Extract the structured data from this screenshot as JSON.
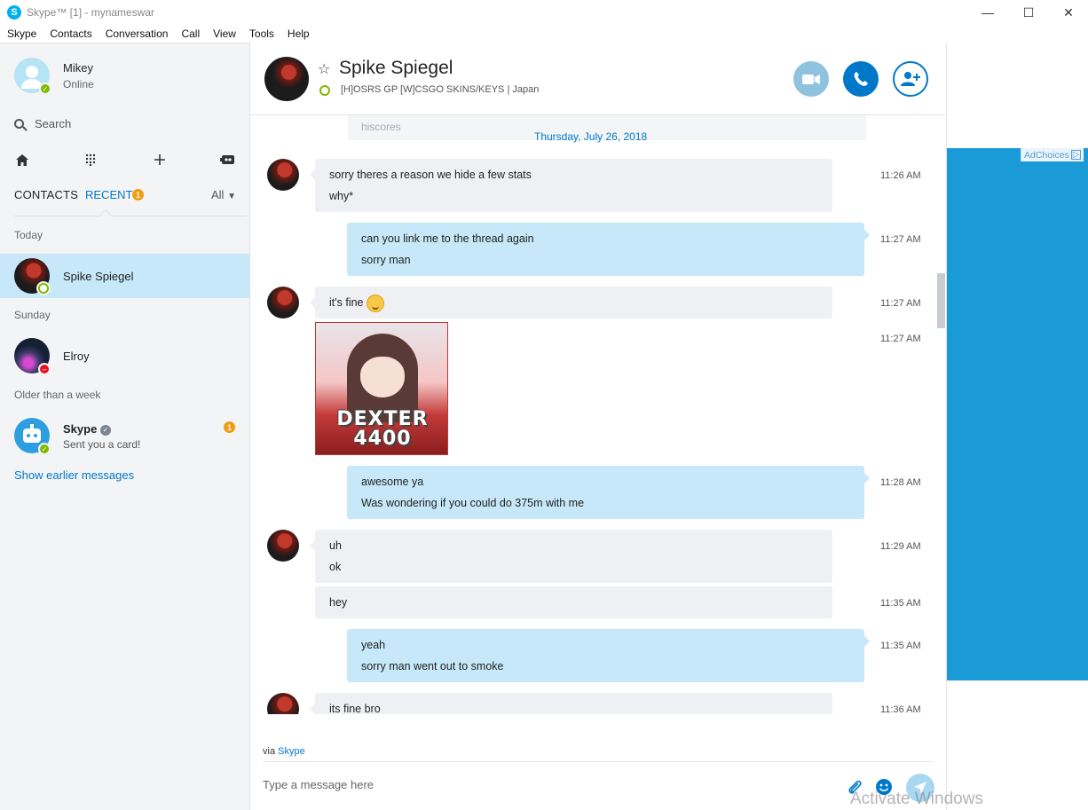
{
  "window": {
    "title": "Skype™ [1] - mynameswar",
    "minimize_glyph": "—",
    "maximize_glyph": "☐",
    "close_glyph": "✕"
  },
  "menu": [
    "Skype",
    "Contacts",
    "Conversation",
    "Call",
    "View",
    "Tools",
    "Help"
  ],
  "sidebar": {
    "me": {
      "name": "Mikey",
      "status": "Online"
    },
    "search_label": "Search",
    "tabs": {
      "contacts": "CONTACTS",
      "recent": "RECENT",
      "recent_badge": "1",
      "filter": "All"
    },
    "groups": {
      "today": "Today",
      "sunday": "Sunday",
      "older": "Older than a week"
    },
    "conversations": [
      {
        "name": "Spike Spiegel",
        "selected": true
      },
      {
        "name": "Elroy"
      },
      {
        "name": "Skype",
        "subtitle": "Sent you a card!",
        "badge": "1"
      }
    ],
    "show_earlier": "Show earlier messages"
  },
  "chat": {
    "contact_name": "Spike Spiegel",
    "mood": "[H]OSRS GP [W]CSGO SKINS/KEYS | Japan",
    "ghost_text": "hiscores",
    "date_label": "Thursday, July 26, 2018",
    "messages": [
      {
        "dir": "in",
        "lines": [
          "sorry theres a reason we hide a few stats",
          "why*"
        ],
        "time": "11:26 AM"
      },
      {
        "dir": "out",
        "lines": [
          "can you link me to the thread again",
          "sorry man"
        ],
        "time": "11:27 AM"
      },
      {
        "dir": "in",
        "lines": [
          "it's fine"
        ],
        "time": "11:27 AM"
      },
      {
        "dir": "in",
        "image_text": [
          "DEXTER",
          "4400"
        ],
        "time": "11:27 AM"
      },
      {
        "dir": "out",
        "lines": [
          "awesome ya",
          "Was wondering if you could do 375m with me"
        ],
        "time": "11:28 AM"
      },
      {
        "dir": "in",
        "lines": [
          "uh",
          "ok"
        ],
        "time": "11:29 AM"
      },
      {
        "dir": "in",
        "lines": [
          "hey"
        ],
        "time": "11:35 AM"
      },
      {
        "dir": "out",
        "lines": [
          "yeah",
          "sorry man went out to smoke"
        ],
        "time": "11:35 AM"
      },
      {
        "dir": "in",
        "lines": [
          "its fine bro"
        ],
        "time": "11:36 AM"
      }
    ],
    "via_prefix": "via",
    "via_link": "Skype",
    "composer_placeholder": "Type a message here"
  },
  "ad": {
    "adchoices": "AdChoices",
    "color": "#1a9ad6"
  },
  "watermark": "Activate Windows",
  "colors": {
    "accent": "#0078ca",
    "selected_row": "#c7e8f8",
    "online": "#7fba00"
  }
}
